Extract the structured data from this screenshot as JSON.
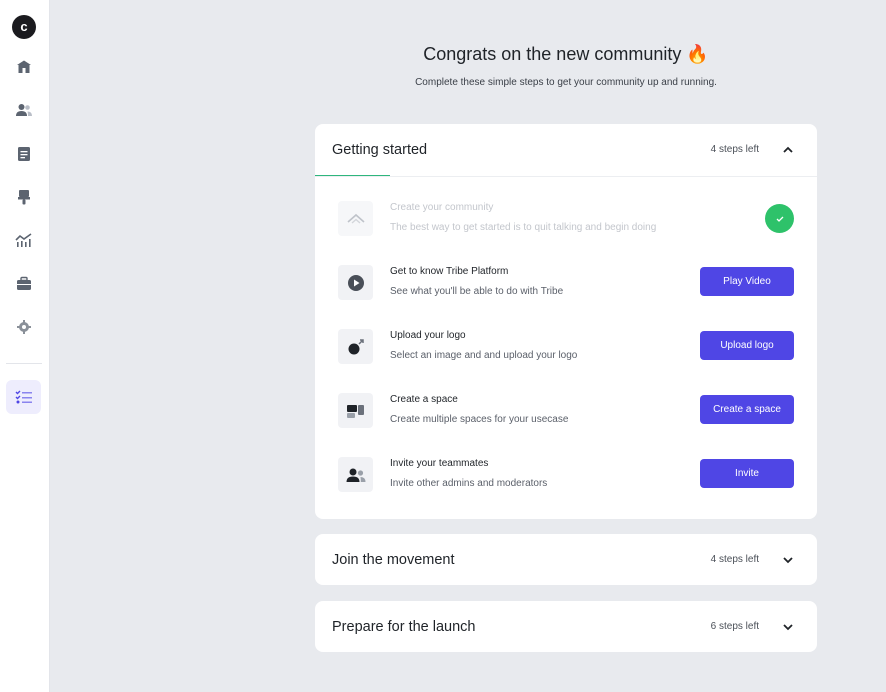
{
  "sidebar": {
    "logo_letter": "c",
    "items": [
      {
        "icon": "home-icon"
      },
      {
        "icon": "members-icon"
      },
      {
        "icon": "content-icon"
      },
      {
        "icon": "appearance-icon"
      },
      {
        "icon": "analytics-icon"
      },
      {
        "icon": "apps-icon"
      },
      {
        "icon": "settings-icon"
      },
      {
        "icon": "checklist-icon",
        "active": true
      }
    ]
  },
  "header": {
    "title": "Congrats on the new community 🔥",
    "subtitle": "Complete these simple steps to get your community up and running."
  },
  "sections": [
    {
      "title": "Getting started",
      "steps_left": "4 steps left",
      "expanded": true,
      "steps": [
        {
          "title": "Create your community",
          "description": "The best way to get started is to quit talking and begin doing",
          "completed": true,
          "icon": "community-icon"
        },
        {
          "title": "Get to know Tribe Platform",
          "description": "See what you'll be able to do with Tribe",
          "button": "Play Video",
          "icon": "play-icon"
        },
        {
          "title": "Upload your logo",
          "description": "Select an image and and upload your logo",
          "button": "Upload logo",
          "icon": "logo-upload-icon"
        },
        {
          "title": "Create a space",
          "description": "Create multiple spaces for your usecase",
          "button": "Create a space",
          "icon": "spaces-icon"
        },
        {
          "title": "Invite your teammates",
          "description": "Invite other admins and moderators",
          "button": "Invite",
          "icon": "teammates-icon"
        }
      ]
    },
    {
      "title": "Join the movement",
      "steps_left": "4 steps left",
      "expanded": false
    },
    {
      "title": "Prepare for the launch",
      "steps_left": "6 steps left",
      "expanded": false
    }
  ],
  "colors": {
    "background": "#e8eaee",
    "primary_button": "#4f46e5",
    "success": "#2ec26a",
    "tab_underline": "#2eb67d"
  }
}
